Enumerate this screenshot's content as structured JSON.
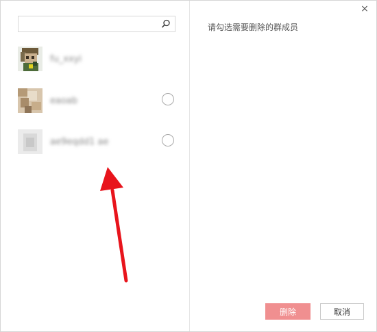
{
  "dialog": {
    "close_glyph": "×",
    "hint_text": "请勾选需要删除的群成员"
  },
  "search": {
    "value": "",
    "placeholder": "",
    "icon": "search-icon"
  },
  "members": [
    {
      "name": "fu_xxyi",
      "avatar": "pixel-avatar-green",
      "selectable": false
    },
    {
      "name": "eaoab",
      "avatar": "photo-avatar-beige",
      "selectable": true,
      "checked": false
    },
    {
      "name": "ae9eqdd1 ae",
      "avatar": "gray-avatar",
      "selectable": true,
      "checked": false
    }
  ],
  "buttons": {
    "delete_label": "删除",
    "cancel_label": "取消"
  },
  "colors": {
    "delete_bg": "#f08f90",
    "arrow": "#e8141c",
    "border": "#d6d6d6"
  }
}
